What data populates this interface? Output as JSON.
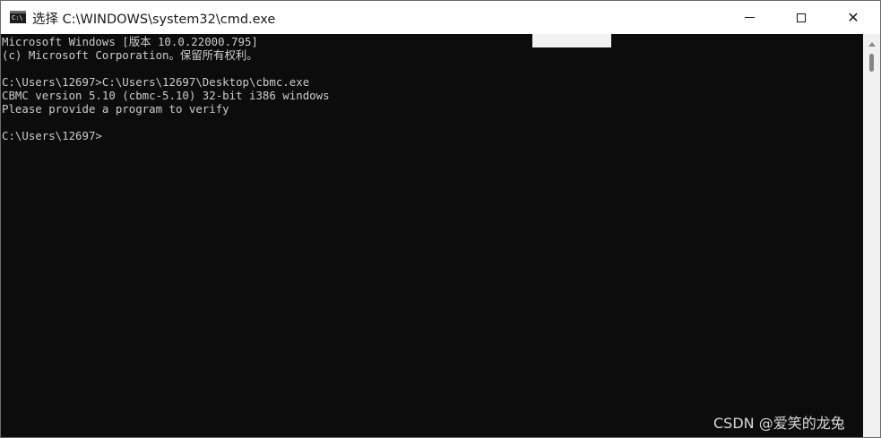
{
  "window": {
    "title": "选择 C:\\WINDOWS\\system32\\cmd.exe",
    "icon_text": "C:\\"
  },
  "controls": {
    "minimize_icon": "minimize-icon",
    "maximize_icon": "maximize-icon",
    "close_icon": "close-icon",
    "close_glyph": "✕"
  },
  "console": {
    "lines": [
      "Microsoft Windows [版本 10.0.22000.795]",
      "(c) Microsoft Corporation。保留所有权利。",
      "",
      "C:\\Users\\12697>C:\\Users\\12697\\Desktop\\cbmc.exe",
      "CBMC version 5.10 (cbmc-5.10) 32-bit i386 windows",
      "Please provide a program to verify",
      "",
      "C:\\Users\\12697>"
    ]
  },
  "watermark": "CSDN @爱笑的龙兔",
  "colors": {
    "console_bg": "#0c0c0c",
    "console_text": "#cccccc",
    "titlebar_bg": "#ffffff"
  }
}
